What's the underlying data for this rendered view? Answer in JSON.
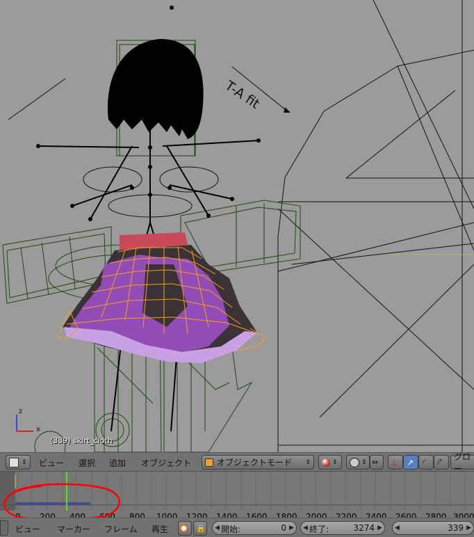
{
  "viewport": {
    "object_info": "(339) skirt_cloth",
    "overlay_text": "T-A fit",
    "axes": {
      "z": "z",
      "x": "x"
    }
  },
  "header3d": {
    "menus": [
      "ビュー",
      "選択",
      "追加",
      "オブジェクト"
    ],
    "mode_label": "オブジェクトモード",
    "orientation_label": "グロー"
  },
  "timeline": {
    "ticks": [
      "0",
      "200",
      "400",
      "600",
      "800",
      "1000",
      "1200",
      "1400",
      "1600",
      "1800",
      "2000",
      "2200",
      "2400",
      "2600",
      "2800",
      "3000"
    ],
    "current_frame": 339
  },
  "footer": {
    "menus": [
      "ビュー",
      "マーカー",
      "フレーム",
      "再生"
    ],
    "start_label": "開始:",
    "start_value": "0",
    "end_label": "終了:",
    "end_value": "3274",
    "current_value": "339"
  },
  "colors": {
    "viewport_bg": "#9b9b9b",
    "annotation_red": "#ff0000",
    "playhead_green": "#55dd22",
    "wire_green": "#1e4a12",
    "skirt_purple": "#9c4fc4",
    "skirt_orange": "#f5a018",
    "active_blue": "#5680c2"
  }
}
